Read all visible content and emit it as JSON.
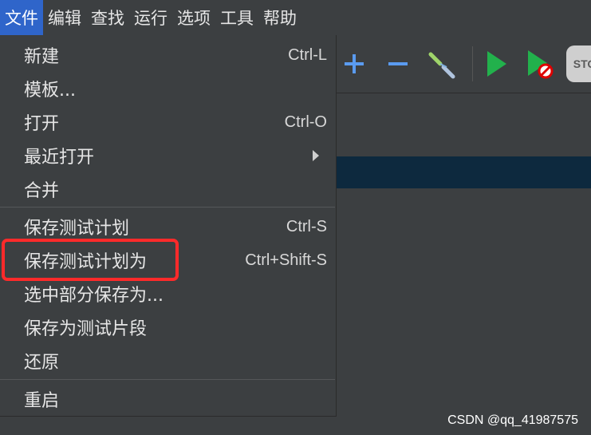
{
  "menubar": {
    "items": [
      {
        "label": "文件",
        "active": true
      },
      {
        "label": "编辑"
      },
      {
        "label": "查找"
      },
      {
        "label": "运行"
      },
      {
        "label": "选项"
      },
      {
        "label": "工具"
      },
      {
        "label": "帮助"
      }
    ]
  },
  "file_menu": {
    "items": [
      {
        "label": "新建",
        "shortcut": "Ctrl-L"
      },
      {
        "label": "模板..."
      },
      {
        "label": "打开",
        "shortcut": "Ctrl-O"
      },
      {
        "label": "最近打开",
        "has_submenu": true
      },
      {
        "label": "合并"
      },
      {
        "label": "保存测试计划",
        "shortcut": "Ctrl-S"
      },
      {
        "label": "保存测试计划为",
        "shortcut": "Ctrl+Shift-S",
        "highlighted": true
      },
      {
        "label": "选中部分保存为..."
      },
      {
        "label": "保存为测试片段"
      },
      {
        "label": "还原"
      },
      {
        "label": "重启"
      }
    ]
  },
  "toolbar": {
    "buttons": [
      {
        "icon": "plus-icon"
      },
      {
        "icon": "minus-icon"
      },
      {
        "icon": "toggle-icon"
      },
      {
        "icon": "play-icon"
      },
      {
        "icon": "play-no-pause-icon"
      },
      {
        "icon": "stop-icon",
        "label": "STO"
      }
    ]
  },
  "colors": {
    "background": "#3c3f41",
    "active_menu": "#2f65ca",
    "selection_row": "#0d293e",
    "highlight_border": "#ff2a2a"
  },
  "watermark": "CSDN @qq_41987575"
}
